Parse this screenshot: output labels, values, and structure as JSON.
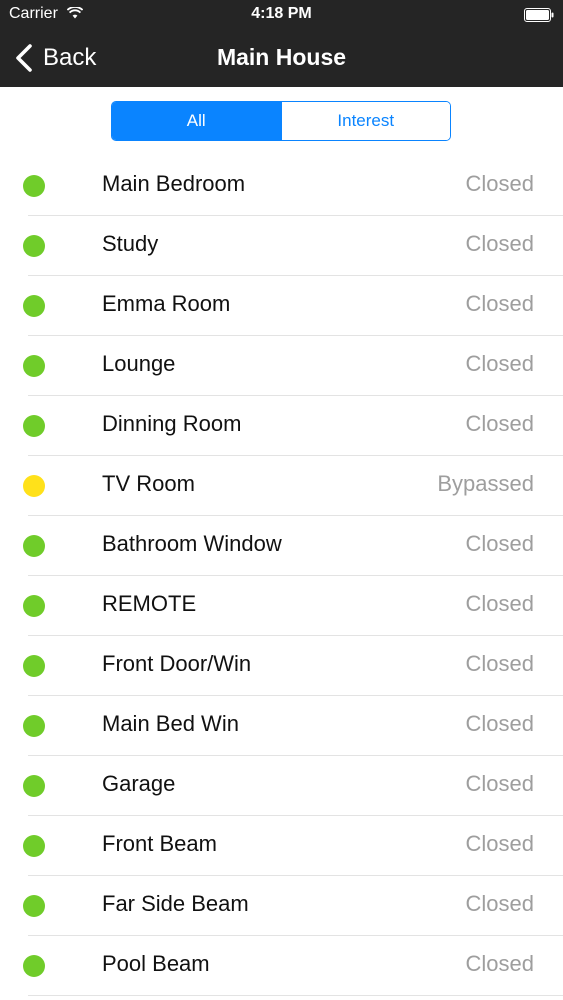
{
  "status_bar": {
    "carrier": "Carrier",
    "time": "4:18 PM",
    "wifi_icon": "wifi-icon",
    "battery_icon": "battery-icon"
  },
  "nav": {
    "back_label": "Back",
    "title": "Main House"
  },
  "segments": {
    "all_label": "All",
    "interest_label": "Interest",
    "selected": "All"
  },
  "colors": {
    "accent": "#0a84ff",
    "closed": "#70cc2a",
    "bypassed": "#ffe11a"
  },
  "zones": [
    {
      "name": "Main Bedroom",
      "status": "Closed",
      "indicator_color": "#70cc2a"
    },
    {
      "name": "Study",
      "status": "Closed",
      "indicator_color": "#70cc2a"
    },
    {
      "name": "Emma Room",
      "status": "Closed",
      "indicator_color": "#70cc2a"
    },
    {
      "name": "Lounge",
      "status": "Closed",
      "indicator_color": "#70cc2a"
    },
    {
      "name": "Dinning Room",
      "status": "Closed",
      "indicator_color": "#70cc2a"
    },
    {
      "name": "TV Room",
      "status": "Bypassed",
      "indicator_color": "#ffe11a"
    },
    {
      "name": "Bathroom Window",
      "status": "Closed",
      "indicator_color": "#70cc2a"
    },
    {
      "name": "REMOTE",
      "status": "Closed",
      "indicator_color": "#70cc2a"
    },
    {
      "name": "Front Door/Win",
      "status": "Closed",
      "indicator_color": "#70cc2a"
    },
    {
      "name": "Main Bed Win",
      "status": "Closed",
      "indicator_color": "#70cc2a"
    },
    {
      "name": "Garage",
      "status": "Closed",
      "indicator_color": "#70cc2a"
    },
    {
      "name": "Front Beam",
      "status": "Closed",
      "indicator_color": "#70cc2a"
    },
    {
      "name": "Far Side Beam",
      "status": "Closed",
      "indicator_color": "#70cc2a"
    },
    {
      "name": "Pool Beam",
      "status": "Closed",
      "indicator_color": "#70cc2a"
    }
  ]
}
